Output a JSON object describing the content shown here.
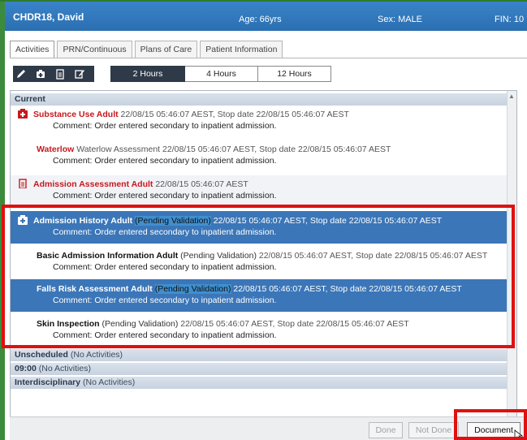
{
  "banner": {
    "name": "CHDR18, David",
    "age": "Age: 66yrs",
    "sex": "Sex: MALE",
    "fin": "FIN: 10"
  },
  "tabs": [
    {
      "label": "Activities",
      "active": true
    },
    {
      "label": "PRN/Continuous",
      "active": false
    },
    {
      "label": "Plans of Care",
      "active": false
    },
    {
      "label": "Patient Information",
      "active": false
    }
  ],
  "toolbar": {
    "icons": [
      "pencil-icon",
      "medkit-icon",
      "clipboard-icon",
      "note-edit-icon"
    ]
  },
  "time_buttons": [
    {
      "label": "2 Hours",
      "active": true
    },
    {
      "label": "4 Hours",
      "active": false
    },
    {
      "label": "12 Hours",
      "active": false
    }
  ],
  "sections": {
    "current": {
      "label": "Current"
    },
    "unscheduled": {
      "label": "Unscheduled",
      "note": "(No Activities)"
    },
    "nine": {
      "label": "09:00",
      "note": "(No Activities)"
    },
    "interdisciplinary": {
      "label": "Interdisciplinary",
      "note": "(No Activities)"
    }
  },
  "activities": [
    {
      "title": "Substance Use Adult",
      "pending": "",
      "meta": " 22/08/15 05:46:07 AEST, Stop date 22/08/15 05:46:07 AEST",
      "comment": "Comment: Order entered secondary to inpatient admission.",
      "icon": "medkit-icon",
      "color": "#c8171d"
    },
    {
      "title": "Waterlow",
      "pending": "",
      "meta": " Waterlow Assessment 22/08/15 05:46:07 AEST, Stop date 22/08/15 05:46:07 AEST",
      "comment": "Comment: Order entered secondary to inpatient admission.",
      "icon": "",
      "color": "#c8171d"
    },
    {
      "title": "Admission Assessment Adult",
      "pending": "",
      "meta": " 22/08/15 05:46:07 AEST",
      "comment": "Comment: Order entered secondary to inpatient admission.",
      "icon": "clipboard-icon",
      "color": "#c8171d"
    },
    {
      "title": "Admission History Adult",
      "pending": "(Pending Validation)",
      "meta": " 22/08/15 05:46:07 AEST, Stop date 22/08/15 05:46:07 AEST",
      "comment": "Comment: Order entered secondary to inpatient admission.",
      "icon": "medkit-icon",
      "color": "#ffffff"
    },
    {
      "title": "Basic Admission Information Adult",
      "pending": "(Pending Validation)",
      "meta": " 22/08/15 05:46:07 AEST, Stop date 22/08/15 05:46:07 AEST",
      "comment": "Comment: Order entered secondary to inpatient admission.",
      "icon": "",
      "color": "#111111"
    },
    {
      "title": "Falls Risk Assessment Adult",
      "pending": "(Pending Validation)",
      "meta": " 22/08/15 05:46:07 AEST, Stop date 22/08/15 05:46:07 AEST",
      "comment": "Comment: Order entered secondary to inpatient admission.",
      "icon": "",
      "color": "#ffffff"
    },
    {
      "title": "Skin Inspection",
      "pending": "(Pending Validation)",
      "meta": " 22/08/15 05:46:07 AEST, Stop date 22/08/15 05:46:07 AEST",
      "comment": "Comment: Order entered secondary to inpatient admission.",
      "icon": "",
      "color": "#111111"
    }
  ],
  "footer": {
    "done": "Done",
    "not_done": "Not Done",
    "document": "Document"
  },
  "colors": {
    "banner": "#3a83c9",
    "selection": "#3b76b8",
    "alert_red": "#c8171d",
    "highlight_box": "#e01010"
  }
}
